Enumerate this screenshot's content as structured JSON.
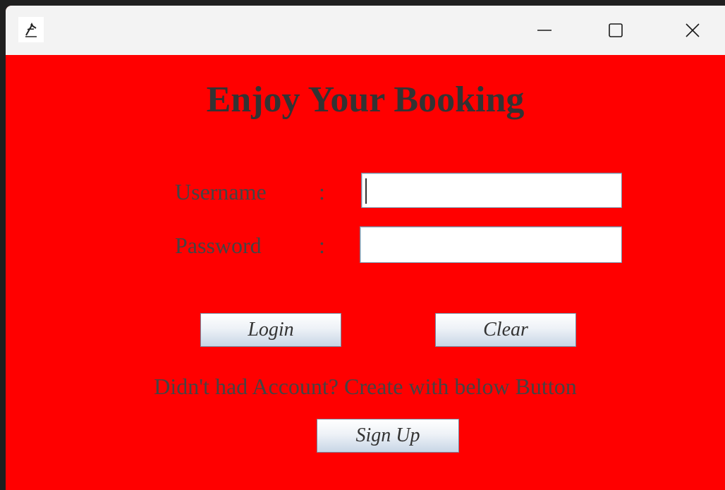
{
  "window": {
    "controls": {
      "minimize_icon": "minimize-icon",
      "maximize_icon": "maximize-icon",
      "close_icon": "close-icon"
    },
    "app_icon": "java-app-icon"
  },
  "login_form": {
    "title": "Enjoy Your Booking",
    "username_label": "Username",
    "username_colon": ":",
    "username_value": "",
    "password_label": "Password",
    "password_colon": ":",
    "password_value": "",
    "login_button": "Login",
    "clear_button": "Clear",
    "signup_hint": "Didn't had Account? Create with below Button",
    "signup_button": "Sign Up"
  },
  "colors": {
    "background": "#ff0000",
    "text": "#444444",
    "title_text": "#333333",
    "titlebar": "#f3f3f3"
  }
}
